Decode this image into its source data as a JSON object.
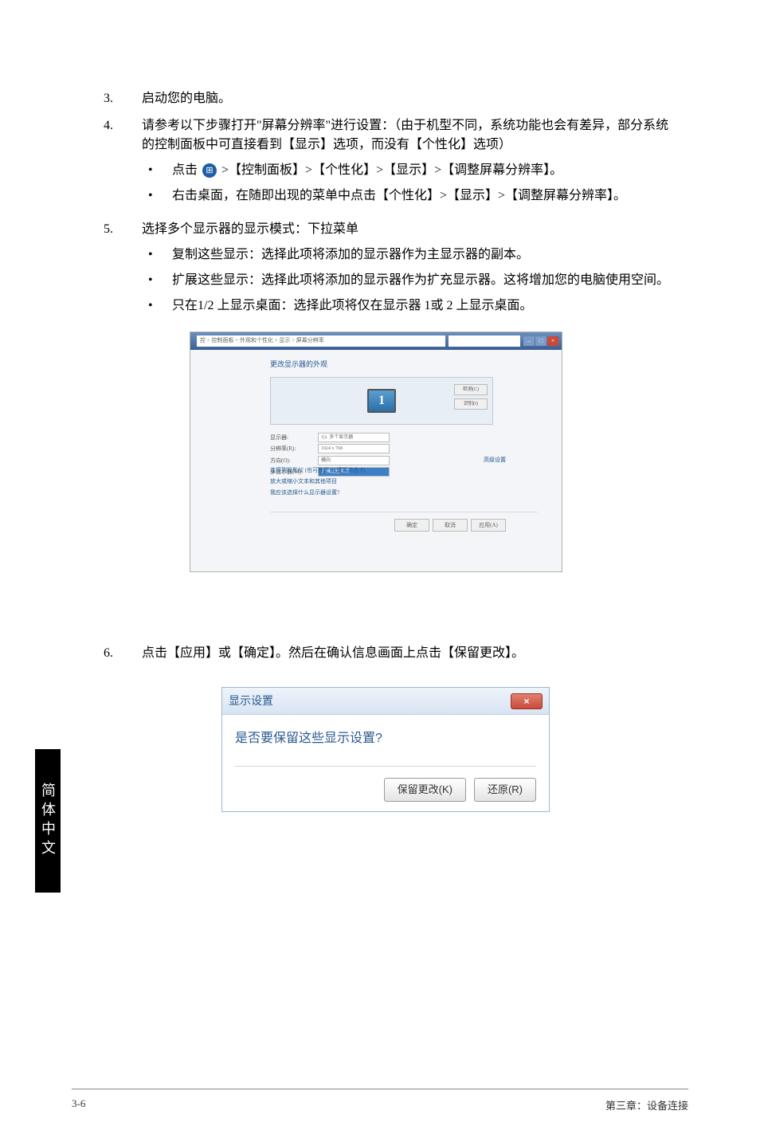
{
  "steps": {
    "s3": {
      "num": "3.",
      "text": "启动您的电脑。"
    },
    "s4": {
      "num": "4.",
      "text": "请参考以下步骤打开\"屏幕分辨率\"进行设置：（由于机型不同，系统功能也会有差异，部分系统的控制面板中可直接看到【显示】选项，而没有【个性化】选项）",
      "sub": [
        {
          "pre": "点击 ",
          "post": " >【控制面板】>【个性化】>【显示】>【调整屏幕分辨率】。"
        },
        {
          "text": "右击桌面，在随即出现的菜单中点击【个性化】>【显示】>【调整屏幕分辨率】。"
        }
      ]
    },
    "s5": {
      "num": "5.",
      "text": "选择多个显示器的显示模式：下拉菜单",
      "sub": [
        "复制这些显示：选择此项将添加的显示器作为主显示器的副本。",
        "扩展这些显示：选择此项将添加的显示器作为扩充显示器。这将增加您的电脑使用空间。",
        "只在1/2 上显示桌面：选择此项将仅在显示器 1或 2 上显示桌面。"
      ]
    },
    "s6": {
      "num": "6.",
      "text": "点击【应用】或【确定】。然后在确认信息画面上点击【保留更改】。"
    }
  },
  "screenshot1": {
    "breadcrumb": "控 > 控制面板 > 外观和个性化 > 显示 > 屏幕分辨率",
    "heading": "更改显示器的外观",
    "monitor_label": "1",
    "side_btn1": "检测(C)",
    "side_btn2": "识别(I)",
    "rows": {
      "display_lbl": "显示器:",
      "display_val": "1|2. 多个显示器",
      "res_lbl": "分辨率(R):",
      "res_val": "1024 x 768",
      "orient_lbl": "方向(O):",
      "orient_val": "横向",
      "multi_lbl": "多显示器(M):",
      "multi_val": "扩展这些显示"
    },
    "links": {
      "l1": "连接到投影仪 (也可按住 ⊞ 键并点击 P)",
      "l2": "放大或缩小文本和其他项目",
      "l3": "我应该选择什么显示器设置?"
    },
    "adv": "高级设置",
    "btn_ok": "确定",
    "btn_cancel": "取消",
    "btn_apply": "应用(A)"
  },
  "screenshot2": {
    "title": "显示设置",
    "question": "是否要保留这些显示设置?",
    "btn_keep": "保留更改(K)",
    "btn_revert": "还原(R)"
  },
  "side_tab": "简体中文",
  "footer": {
    "left": "3-6",
    "right": "第三章：设备连接"
  }
}
